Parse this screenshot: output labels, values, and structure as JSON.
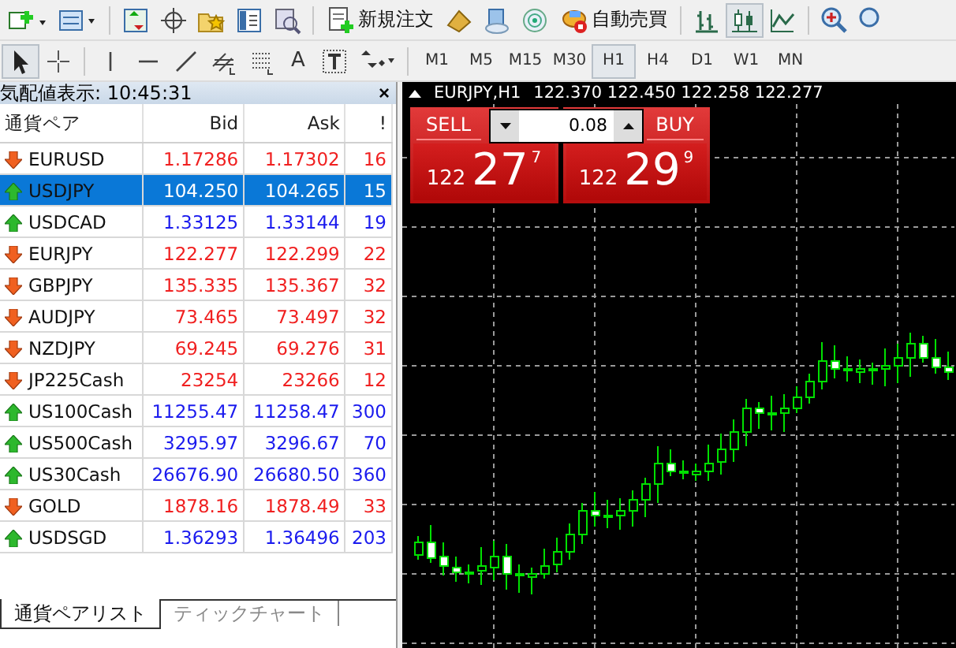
{
  "toolbar": {
    "order_button": "新規注文",
    "autotrade_button": "自動売買"
  },
  "drawing_toolbar": {
    "text_tool": "A",
    "timeframes": [
      {
        "label": "M1",
        "selected": false
      },
      {
        "label": "M5",
        "selected": false
      },
      {
        "label": "M15",
        "selected": false
      },
      {
        "label": "M30",
        "selected": false
      },
      {
        "label": "H1",
        "selected": true
      },
      {
        "label": "H4",
        "selected": false
      },
      {
        "label": "D1",
        "selected": false
      },
      {
        "label": "W1",
        "selected": false
      },
      {
        "label": "MN",
        "selected": false
      }
    ]
  },
  "market_watch": {
    "title": "気配値表示: 10:45:31",
    "close": "×",
    "columns": [
      "通貨ペア",
      "Bid",
      "Ask",
      "!"
    ],
    "rows": [
      {
        "symbol": "EURUSD",
        "bid": "1.17286",
        "ask": "1.17302",
        "spread": "16",
        "rising": false,
        "selected": false
      },
      {
        "symbol": "USDJPY",
        "bid": "104.250",
        "ask": "104.265",
        "spread": "15",
        "rising": true,
        "selected": true
      },
      {
        "symbol": "USDCAD",
        "bid": "1.33125",
        "ask": "1.33144",
        "spread": "19",
        "rising": true,
        "selected": false
      },
      {
        "symbol": "EURJPY",
        "bid": "122.277",
        "ask": "122.299",
        "spread": "22",
        "rising": false,
        "selected": false
      },
      {
        "symbol": "GBPJPY",
        "bid": "135.335",
        "ask": "135.367",
        "spread": "32",
        "rising": false,
        "selected": false
      },
      {
        "symbol": "AUDJPY",
        "bid": "73.465",
        "ask": "73.497",
        "spread": "32",
        "rising": false,
        "selected": false
      },
      {
        "symbol": "NZDJPY",
        "bid": "69.245",
        "ask": "69.276",
        "spread": "31",
        "rising": false,
        "selected": false
      },
      {
        "symbol": "JP225Cash",
        "bid": "23254",
        "ask": "23266",
        "spread": "12",
        "rising": false,
        "selected": false
      },
      {
        "symbol": "US100Cash",
        "bid": "11255.47",
        "ask": "11258.47",
        "spread": "300",
        "rising": true,
        "selected": false
      },
      {
        "symbol": "US500Cash",
        "bid": "3295.97",
        "ask": "3296.67",
        "spread": "70",
        "rising": true,
        "selected": false
      },
      {
        "symbol": "US30Cash",
        "bid": "26676.90",
        "ask": "26680.50",
        "spread": "360",
        "rising": true,
        "selected": false
      },
      {
        "symbol": "GOLD",
        "bid": "1878.16",
        "ask": "1878.49",
        "spread": "33",
        "rising": false,
        "selected": false
      },
      {
        "symbol": "USDSGD",
        "bid": "1.36293",
        "ask": "1.36496",
        "spread": "203",
        "rising": true,
        "selected": false
      }
    ],
    "tabs": [
      {
        "label": "通貨ペアリスト",
        "selected": true
      },
      {
        "label": "ティックチャート",
        "selected": false
      }
    ]
  },
  "chart": {
    "symbol": "EURJPY,H1",
    "ohlc": "122.370 122.450 122.258 122.277",
    "trade_panel": {
      "sell_label": "SELL",
      "buy_label": "BUY",
      "lot": "0.08",
      "sell_price": {
        "big_figure": "122",
        "pips": "27",
        "fraction": "7"
      },
      "buy_price": {
        "big_figure": "122",
        "pips": "29",
        "fraction": "9"
      }
    }
  }
}
